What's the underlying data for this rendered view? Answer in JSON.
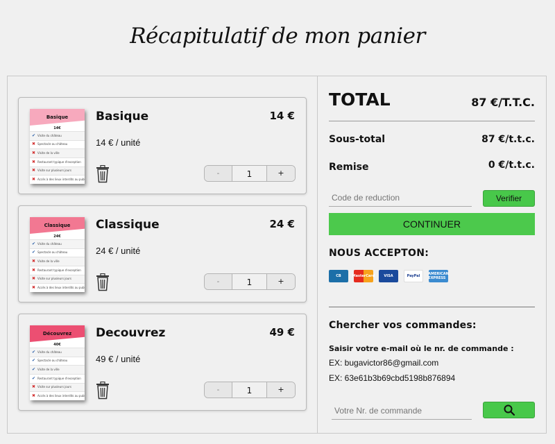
{
  "page": {
    "title": "Récapitulatif de mon panier"
  },
  "cart": {
    "items": [
      {
        "name": "Basique",
        "price": "14 €",
        "unit_price": "14 € / unité",
        "quantity": "1",
        "thumb_title": "Basique",
        "thumb_price": "14€",
        "thumb_color": "#f7a9bd",
        "features": [
          {
            "ok": true,
            "text": "Visite du château"
          },
          {
            "ok": false,
            "text": "Spectacle au château"
          },
          {
            "ok": false,
            "text": "Visite de la ville"
          },
          {
            "ok": false,
            "text": "Restaurant typique d'exception"
          },
          {
            "ok": false,
            "text": "Visite sur plusieurs jours"
          },
          {
            "ok": false,
            "text": "Accès à des lieux interdits au public"
          }
        ]
      },
      {
        "name": "Classique",
        "price": "24 €",
        "unit_price": "24 € / unité",
        "quantity": "1",
        "thumb_title": "Classique",
        "thumb_price": "24€",
        "thumb_color": "#f27892",
        "features": [
          {
            "ok": true,
            "text": "Visite du château"
          },
          {
            "ok": true,
            "text": "Spectacle au château"
          },
          {
            "ok": false,
            "text": "Visite de la ville"
          },
          {
            "ok": false,
            "text": "Restaurant typique d'exception"
          },
          {
            "ok": false,
            "text": "Visite sur plusieurs jours"
          },
          {
            "ok": false,
            "text": "Accès à des lieux interdits au public"
          }
        ]
      },
      {
        "name": "Decouvrez",
        "price": "49 €",
        "unit_price": "49 € / unité",
        "quantity": "1",
        "thumb_title": "Découvrez",
        "thumb_price": "40€",
        "thumb_color": "#ec4f72",
        "features": [
          {
            "ok": true,
            "text": "Visite du château"
          },
          {
            "ok": true,
            "text": "Spectacle au château"
          },
          {
            "ok": true,
            "text": "Visite de la ville"
          },
          {
            "ok": true,
            "text": "Restaurant typique d'exception"
          },
          {
            "ok": false,
            "text": "Visite sur plusieurs jours"
          },
          {
            "ok": false,
            "text": "Accès à des lieux interdits au public"
          }
        ]
      }
    ],
    "minus_label": "-",
    "plus_label": "+"
  },
  "summary": {
    "total_label": "TOTAL",
    "total_value": "87 €/T.T.C.",
    "subtotal_label": "Sous-total",
    "subtotal_value": "87 €/t.t.c.",
    "discount_label": "Remise",
    "discount_value": "0 €/t.t.c.",
    "code_placeholder": "Code de reduction",
    "verify_label": "Verifier",
    "continue_label": "CONTINUER",
    "accept_title": "NOUS ACCEPTON:",
    "payments": [
      {
        "icon": "cb-card-icon",
        "label": "CB",
        "color": "#1c6fa8"
      },
      {
        "icon": "mastercard-icon",
        "label": "MasterCard",
        "color": "#222"
      },
      {
        "icon": "visa-icon",
        "label": "VISA",
        "color": "#1a4a9c"
      },
      {
        "icon": "paypal-icon",
        "label": "PayPal",
        "color": "#ffffff"
      },
      {
        "icon": "amex-icon",
        "label": "AMERICAN EXPRESS",
        "color": "#3b8bd0"
      }
    ]
  },
  "orders": {
    "title": "Chercher vos commandes:",
    "help": "Saisir votre e-mail où le nr. de commande :",
    "example_email": "EX: bugavictor86@gmail.com",
    "example_id": "EX: 63e61b3b69cbd5198b876894",
    "placeholder": "Votre Nr. de commande"
  },
  "colors": {
    "accent_green": "#4cc94c",
    "background": "#f0f0f0"
  }
}
